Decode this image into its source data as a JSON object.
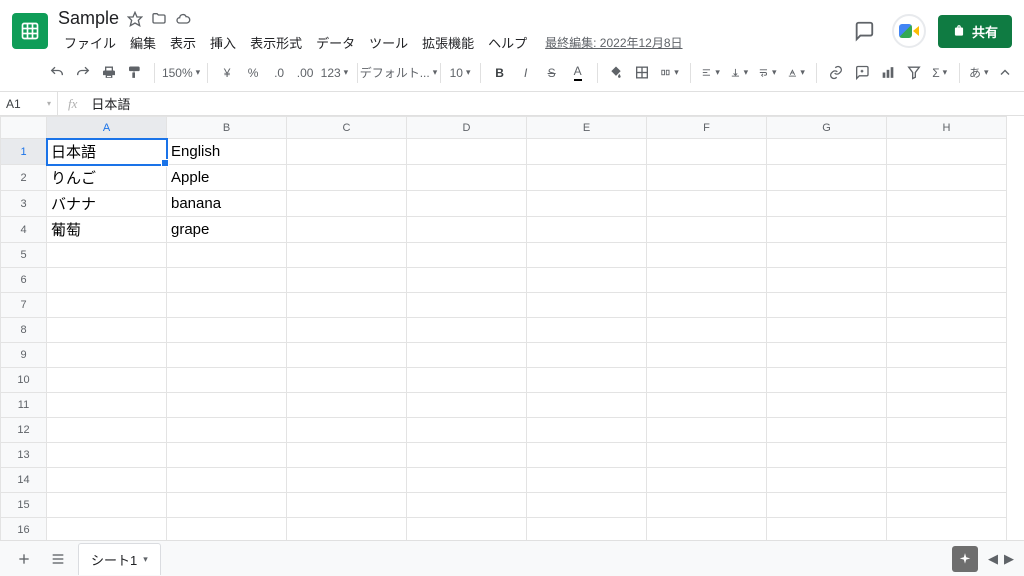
{
  "doc": {
    "title": "Sample"
  },
  "menubar": {
    "items": [
      "ファイル",
      "編集",
      "表示",
      "挿入",
      "表示形式",
      "データ",
      "ツール",
      "拡張機能",
      "ヘルプ"
    ],
    "last_edit": "最終編集: 2022年12月8日"
  },
  "share": {
    "label": "共有"
  },
  "toolbar": {
    "zoom": "150%",
    "currency": "¥",
    "percent": "%",
    "dec_dec": ".0",
    "dec_inc": ".00",
    "num_format": "123",
    "font": "デフォルト...",
    "font_size": "10",
    "ime": "あ"
  },
  "name_box": "A1",
  "formula": "日本語",
  "columns": [
    "A",
    "B",
    "C",
    "D",
    "E",
    "F",
    "G",
    "H"
  ],
  "row_count": 16,
  "selected": {
    "col": 0,
    "row": 0
  },
  "cells": {
    "r1": {
      "A": "日本語",
      "B": "English"
    },
    "r2": {
      "A": "りんご",
      "B": "Apple"
    },
    "r3": {
      "A": "バナナ",
      "B": "banana"
    },
    "r4": {
      "A": "葡萄",
      "B": "grape"
    }
  },
  "sheet_tab": "シート1"
}
